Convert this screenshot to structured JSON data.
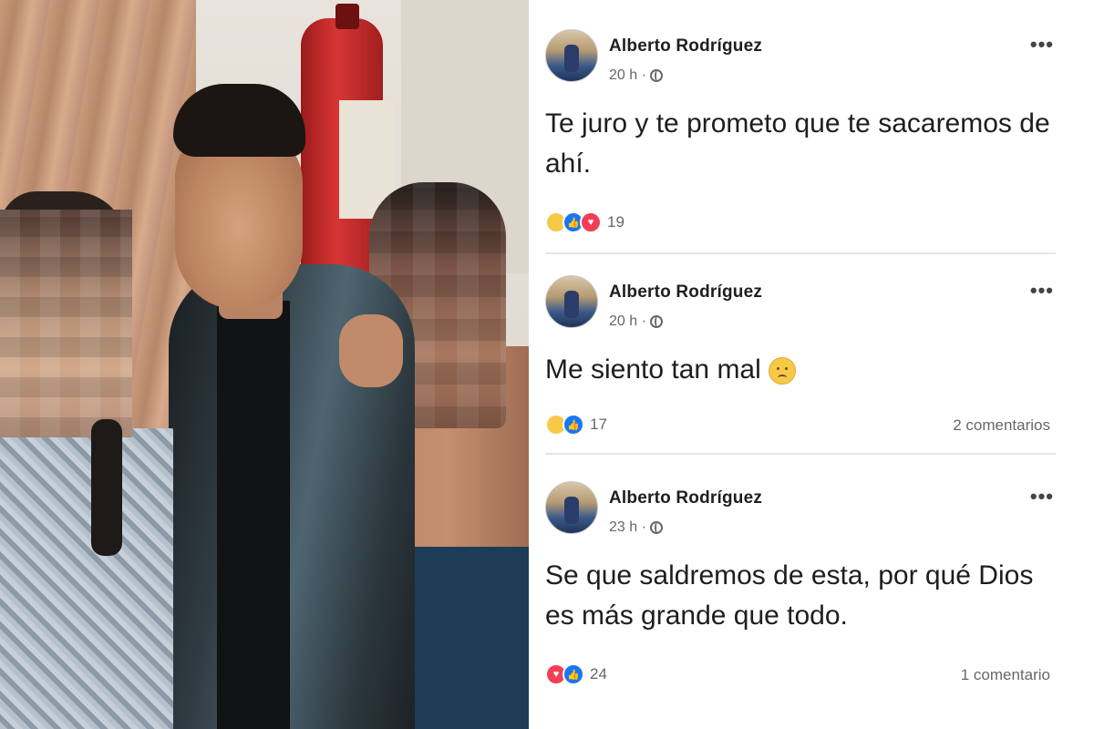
{
  "posts": [
    {
      "author": "Alberto Rodríguez",
      "time": "20 h ·",
      "text": "Te juro y te prometo que te sacaremos de ahí.",
      "reaction_count": "19",
      "comments": "",
      "reactions": [
        "sad",
        "like",
        "love"
      ]
    },
    {
      "author": "Alberto Rodríguez",
      "time": "20 h ·",
      "text": "Me siento tan mal",
      "reaction_count": "17",
      "comments": "2 comentarios",
      "reactions": [
        "sad",
        "like"
      ]
    },
    {
      "author": "Alberto Rodríguez",
      "time": "23 h ·",
      "text": "Se que saldremos de esta, por qué Dios es más grande que todo.",
      "reaction_count": "24",
      "comments": "1 comentario",
      "reactions": [
        "love",
        "like"
      ]
    }
  ],
  "icons": {
    "more": "more-options-icon",
    "privacy": "globe-icon",
    "emoji": "sad-face-emoji"
  },
  "colors": {
    "like": "#1877f2",
    "love": "#f33e58",
    "sad": "#f7c948",
    "secondary_text": "#65676b"
  }
}
